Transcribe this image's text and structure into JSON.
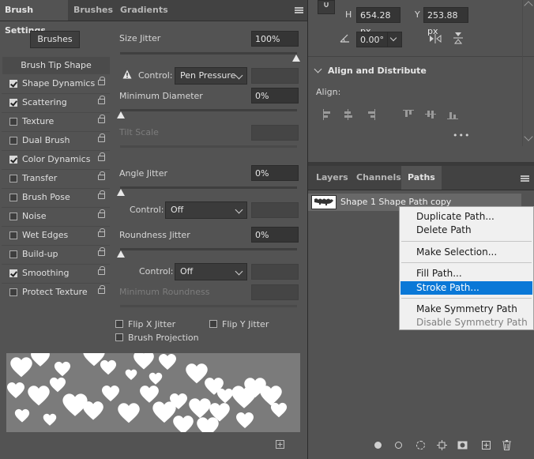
{
  "brush_settings": {
    "tabs": [
      "Brush Settings",
      "Brushes",
      "Gradients"
    ],
    "brushes_button": "Brushes",
    "list_header": "Brush Tip Shape",
    "items": [
      {
        "label": "Shape Dynamics",
        "checked": true
      },
      {
        "label": "Scattering",
        "checked": true
      },
      {
        "label": "Texture",
        "checked": false
      },
      {
        "label": "Dual Brush",
        "checked": false
      },
      {
        "label": "Color Dynamics",
        "checked": true
      },
      {
        "label": "Transfer",
        "checked": false
      },
      {
        "label": "Brush Pose",
        "checked": false
      },
      {
        "label": "Noise",
        "checked": false
      },
      {
        "label": "Wet Edges",
        "checked": false
      },
      {
        "label": "Build-up",
        "checked": false
      },
      {
        "label": "Smoothing",
        "checked": true
      },
      {
        "label": "Protect Texture",
        "checked": false
      }
    ],
    "size_jitter": {
      "label": "Size Jitter",
      "value": "100%",
      "level": 1.0
    },
    "control1": {
      "label": "Control:",
      "value": "Pen Pressure"
    },
    "minimum_diameter": {
      "label": "Minimum Diameter",
      "value": "0%",
      "level": 0.0
    },
    "tilt_scale": {
      "label": "Tilt Scale"
    },
    "angle_jitter": {
      "label": "Angle Jitter",
      "value": "0%",
      "level": 0.0
    },
    "control2": {
      "label": "Control:",
      "value": "Off"
    },
    "roundness_jitter": {
      "label": "Roundness Jitter",
      "value": "0%",
      "level": 0.0
    },
    "control3": {
      "label": "Control:",
      "value": "Off"
    },
    "minimum_roundness": {
      "label": "Minimum Roundness"
    },
    "flip_x": "Flip X Jitter",
    "flip_y": "Flip Y Jitter",
    "brush_projection": "Brush Projection"
  },
  "properties": {
    "h_label": "H",
    "h_value": "654.28 px",
    "y_label": "Y",
    "y_value": "253.88 px",
    "angle_value": "0.00°",
    "align_section": "Align and Distribute",
    "align_label": "Align:",
    "more": "•••"
  },
  "paths_panel": {
    "tabs": [
      "Layers",
      "Channels",
      "Paths"
    ],
    "path_name": "Shape 1 Shape Path copy"
  },
  "context_menu": {
    "items": [
      {
        "label": "Duplicate Path...",
        "state": "normal"
      },
      {
        "label": "Delete Path",
        "state": "normal"
      },
      {
        "label": "Make Selection...",
        "state": "normal"
      },
      {
        "label": "Fill Path...",
        "state": "normal"
      },
      {
        "label": "Stroke Path...",
        "state": "highlighted"
      },
      {
        "label": "Make Symmetry Path",
        "state": "normal"
      },
      {
        "label": "Disable Symmetry Path",
        "state": "disabled"
      }
    ]
  },
  "colors": {
    "highlight": "#0a78d7",
    "panel": "#535353",
    "context_bg": "#f0f0f0"
  }
}
